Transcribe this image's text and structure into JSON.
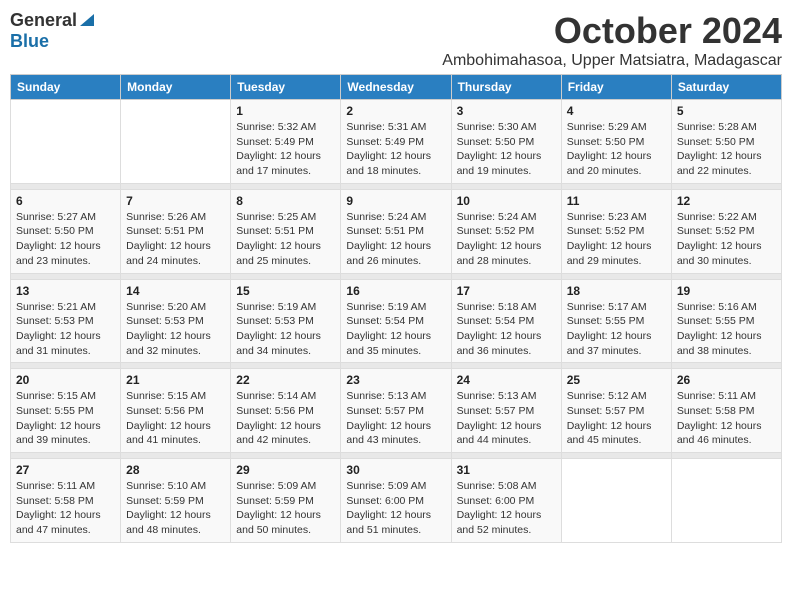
{
  "header": {
    "logo_general": "General",
    "logo_blue": "Blue",
    "month_title": "October 2024",
    "location": "Ambohimahasoa, Upper Matsiatra, Madagascar"
  },
  "weekdays": [
    "Sunday",
    "Monday",
    "Tuesday",
    "Wednesday",
    "Thursday",
    "Friday",
    "Saturday"
  ],
  "weeks": [
    [
      {
        "day": "",
        "info": ""
      },
      {
        "day": "",
        "info": ""
      },
      {
        "day": "1",
        "sunrise": "5:32 AM",
        "sunset": "5:49 PM",
        "daylight": "12 hours and 17 minutes."
      },
      {
        "day": "2",
        "sunrise": "5:31 AM",
        "sunset": "5:49 PM",
        "daylight": "12 hours and 18 minutes."
      },
      {
        "day": "3",
        "sunrise": "5:30 AM",
        "sunset": "5:50 PM",
        "daylight": "12 hours and 19 minutes."
      },
      {
        "day": "4",
        "sunrise": "5:29 AM",
        "sunset": "5:50 PM",
        "daylight": "12 hours and 20 minutes."
      },
      {
        "day": "5",
        "sunrise": "5:28 AM",
        "sunset": "5:50 PM",
        "daylight": "12 hours and 22 minutes."
      }
    ],
    [
      {
        "day": "6",
        "sunrise": "5:27 AM",
        "sunset": "5:50 PM",
        "daylight": "12 hours and 23 minutes."
      },
      {
        "day": "7",
        "sunrise": "5:26 AM",
        "sunset": "5:51 PM",
        "daylight": "12 hours and 24 minutes."
      },
      {
        "day": "8",
        "sunrise": "5:25 AM",
        "sunset": "5:51 PM",
        "daylight": "12 hours and 25 minutes."
      },
      {
        "day": "9",
        "sunrise": "5:24 AM",
        "sunset": "5:51 PM",
        "daylight": "12 hours and 26 minutes."
      },
      {
        "day": "10",
        "sunrise": "5:24 AM",
        "sunset": "5:52 PM",
        "daylight": "12 hours and 28 minutes."
      },
      {
        "day": "11",
        "sunrise": "5:23 AM",
        "sunset": "5:52 PM",
        "daylight": "12 hours and 29 minutes."
      },
      {
        "day": "12",
        "sunrise": "5:22 AM",
        "sunset": "5:52 PM",
        "daylight": "12 hours and 30 minutes."
      }
    ],
    [
      {
        "day": "13",
        "sunrise": "5:21 AM",
        "sunset": "5:53 PM",
        "daylight": "12 hours and 31 minutes."
      },
      {
        "day": "14",
        "sunrise": "5:20 AM",
        "sunset": "5:53 PM",
        "daylight": "12 hours and 32 minutes."
      },
      {
        "day": "15",
        "sunrise": "5:19 AM",
        "sunset": "5:53 PM",
        "daylight": "12 hours and 34 minutes."
      },
      {
        "day": "16",
        "sunrise": "5:19 AM",
        "sunset": "5:54 PM",
        "daylight": "12 hours and 35 minutes."
      },
      {
        "day": "17",
        "sunrise": "5:18 AM",
        "sunset": "5:54 PM",
        "daylight": "12 hours and 36 minutes."
      },
      {
        "day": "18",
        "sunrise": "5:17 AM",
        "sunset": "5:55 PM",
        "daylight": "12 hours and 37 minutes."
      },
      {
        "day": "19",
        "sunrise": "5:16 AM",
        "sunset": "5:55 PM",
        "daylight": "12 hours and 38 minutes."
      }
    ],
    [
      {
        "day": "20",
        "sunrise": "5:15 AM",
        "sunset": "5:55 PM",
        "daylight": "12 hours and 39 minutes."
      },
      {
        "day": "21",
        "sunrise": "5:15 AM",
        "sunset": "5:56 PM",
        "daylight": "12 hours and 41 minutes."
      },
      {
        "day": "22",
        "sunrise": "5:14 AM",
        "sunset": "5:56 PM",
        "daylight": "12 hours and 42 minutes."
      },
      {
        "day": "23",
        "sunrise": "5:13 AM",
        "sunset": "5:57 PM",
        "daylight": "12 hours and 43 minutes."
      },
      {
        "day": "24",
        "sunrise": "5:13 AM",
        "sunset": "5:57 PM",
        "daylight": "12 hours and 44 minutes."
      },
      {
        "day": "25",
        "sunrise": "5:12 AM",
        "sunset": "5:57 PM",
        "daylight": "12 hours and 45 minutes."
      },
      {
        "day": "26",
        "sunrise": "5:11 AM",
        "sunset": "5:58 PM",
        "daylight": "12 hours and 46 minutes."
      }
    ],
    [
      {
        "day": "27",
        "sunrise": "5:11 AM",
        "sunset": "5:58 PM",
        "daylight": "12 hours and 47 minutes."
      },
      {
        "day": "28",
        "sunrise": "5:10 AM",
        "sunset": "5:59 PM",
        "daylight": "12 hours and 48 minutes."
      },
      {
        "day": "29",
        "sunrise": "5:09 AM",
        "sunset": "5:59 PM",
        "daylight": "12 hours and 50 minutes."
      },
      {
        "day": "30",
        "sunrise": "5:09 AM",
        "sunset": "6:00 PM",
        "daylight": "12 hours and 51 minutes."
      },
      {
        "day": "31",
        "sunrise": "5:08 AM",
        "sunset": "6:00 PM",
        "daylight": "12 hours and 52 minutes."
      },
      {
        "day": "",
        "info": ""
      },
      {
        "day": "",
        "info": ""
      }
    ]
  ],
  "labels": {
    "sunrise": "Sunrise:",
    "sunset": "Sunset:",
    "daylight": "Daylight:"
  }
}
